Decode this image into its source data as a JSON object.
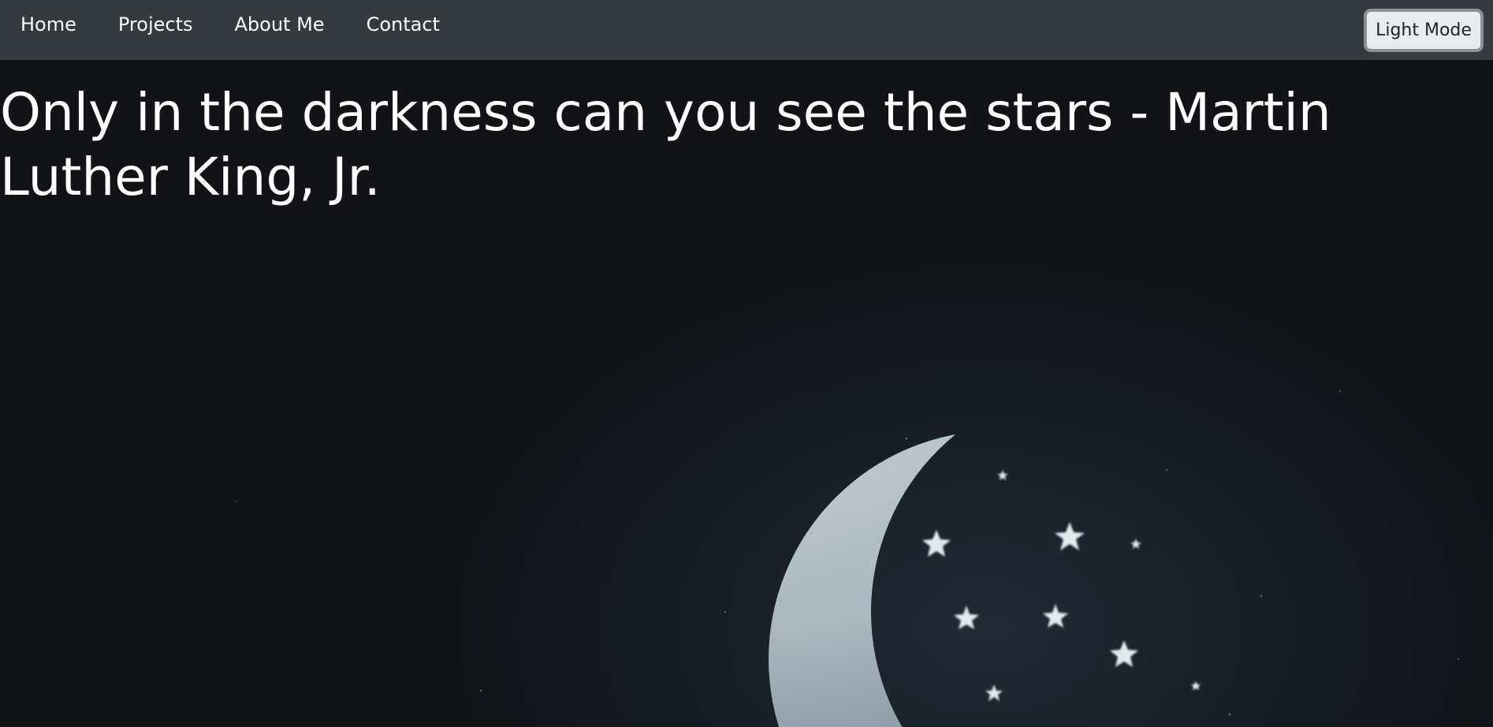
{
  "nav": {
    "links": [
      {
        "label": "Home"
      },
      {
        "label": "Projects"
      },
      {
        "label": "About Me"
      },
      {
        "label": "Contact"
      }
    ],
    "mode_toggle_label": "Light Mode"
  },
  "hero": {
    "quote": "Only in the darkness can you see the stars - Martin Luther King, Jr.",
    "image": "crescent-moon-with-stars",
    "colors": {
      "navbar": "#343a40",
      "page_background": "#121317",
      "moon": "#b9c6cf",
      "stars": "#e4e9ee"
    }
  }
}
